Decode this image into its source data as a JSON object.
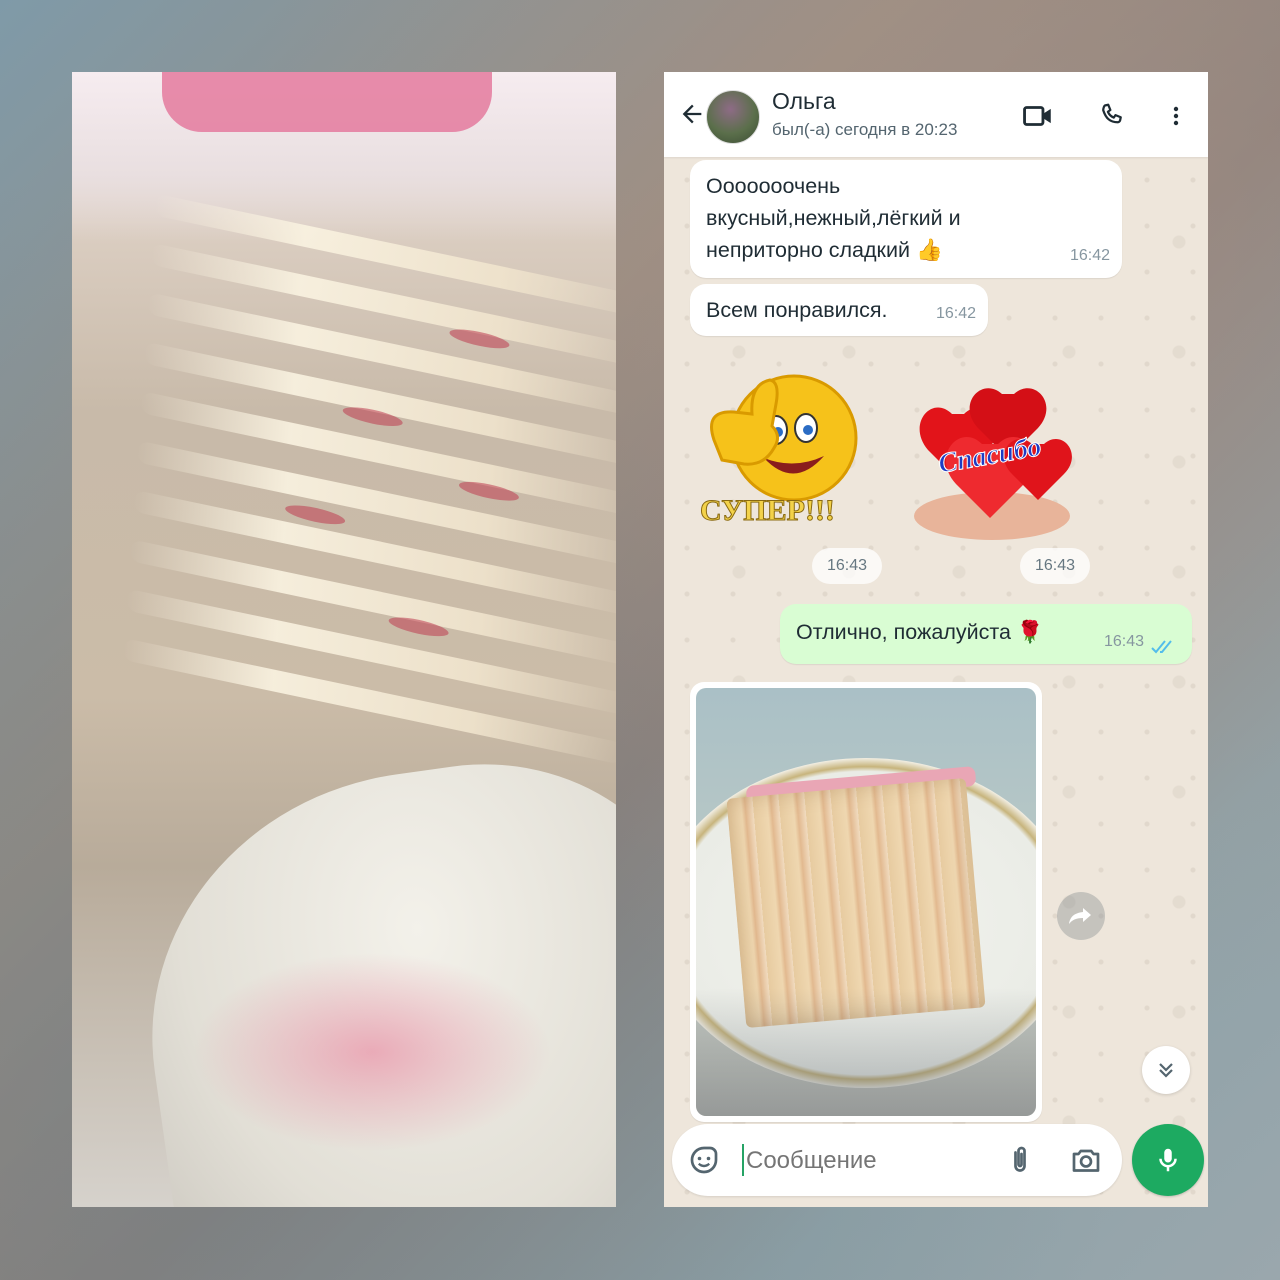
{
  "chat": {
    "contact_name": "Ольга",
    "last_seen": "был(-а) сегодня в 20:23",
    "messages": [
      {
        "direction": "in",
        "text_lines": [
          "Ооооооочень",
          "вкусный,нежный,лёгкий и",
          "неприторно сладкий 👍"
        ],
        "time": "16:42"
      },
      {
        "direction": "in",
        "text": "Всем понравился.",
        "time": "16:42"
      },
      {
        "direction": "in",
        "type": "sticker",
        "sticker_text": "СУПЕР!!!",
        "icon": "thumbs-up-smiley",
        "time": "16:43"
      },
      {
        "direction": "in",
        "type": "sticker",
        "sticker_text": "Спасибо",
        "icon": "hearts-in-hands",
        "time": "16:43"
      },
      {
        "direction": "out",
        "text": "Отлично, пожалуйста 🌹",
        "time": "16:43",
        "status": "read"
      },
      {
        "direction": "in",
        "type": "image",
        "icon": "cake-slice-photo"
      }
    ]
  },
  "composer": {
    "placeholder": "Сообщение"
  },
  "colors": {
    "outgoing_bubble": "#d9fdd3",
    "mic_button": "#1daa61",
    "read_ticks": "#53bdeb"
  },
  "icons": [
    "back-arrow-icon",
    "video-call-icon",
    "phone-icon",
    "more-menu-icon",
    "sticker-icon",
    "attach-icon",
    "camera-icon",
    "mic-icon",
    "forward-icon",
    "scroll-down-icon"
  ]
}
